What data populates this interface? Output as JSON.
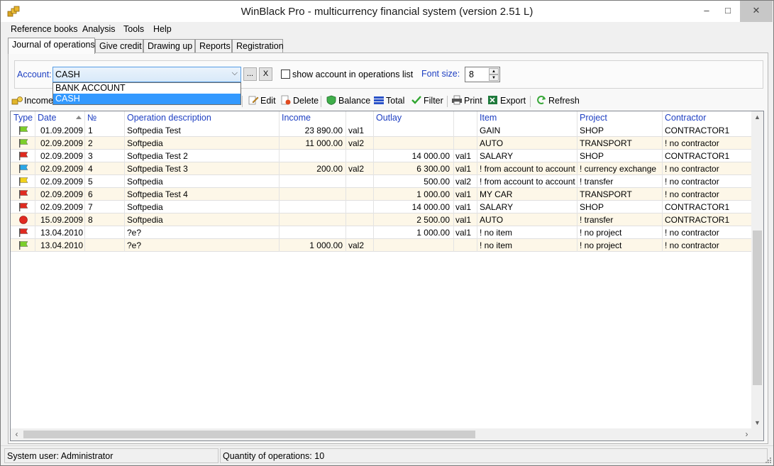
{
  "window": {
    "title": "WinBlack Pro - multicurrency financial system (version 2.51 L)",
    "minimize": "–",
    "maximize": "□",
    "close": "✕"
  },
  "menu": [
    "Reference books",
    "Analysis",
    "Tools",
    "Help"
  ],
  "tabs": [
    "Journal of operations",
    "Give credit",
    "Drawing up",
    "Reports",
    "Registration"
  ],
  "account": {
    "label": "Account:",
    "value": "CASH",
    "browse_label": "...",
    "clear_label": "X",
    "show_in_list_label": "show account in operations list",
    "show_in_list_checked": false,
    "font_size_label": "Font size:",
    "font_size_value": "8",
    "dropdown_options": [
      "BANK ACCOUNT",
      "CASH"
    ],
    "dropdown_selected": "CASH"
  },
  "toolbar": {
    "income": "Income",
    "edit": "Edit",
    "delete": "Delete",
    "balance": "Balance",
    "total": "Total",
    "filter": "Filter",
    "print": "Print",
    "export": "Export",
    "refresh": "Refresh"
  },
  "grid": {
    "columns": [
      "Type",
      "Date",
      "№",
      "Operation description",
      "Income",
      "Outlay",
      "Item",
      "Project",
      "Contractor"
    ],
    "sorted_column": "Date",
    "rows": [
      {
        "type": "green",
        "date": "01.09.2009",
        "no": "1",
        "desc": "Softpedia Test",
        "income": "23 890.00",
        "income_cur": "val1",
        "outlay": "",
        "outlay_cur": "",
        "item": "GAIN",
        "project": "SHOP",
        "contractor": "CONTRACTOR1"
      },
      {
        "type": "green",
        "date": "02.09.2009",
        "no": "2",
        "desc": "Softpedia",
        "income": "11 000.00",
        "income_cur": "val2",
        "outlay": "",
        "outlay_cur": "",
        "item": "AUTO",
        "project": "TRANSPORT",
        "contractor": "! no contractor"
      },
      {
        "type": "red",
        "date": "02.09.2009",
        "no": "3",
        "desc": "Softpedia Test 2",
        "income": "",
        "income_cur": "",
        "outlay": "14 000.00",
        "outlay_cur": "val1",
        "item": "SALARY",
        "project": "SHOP",
        "contractor": "CONTRACTOR1"
      },
      {
        "type": "blue",
        "date": "02.09.2009",
        "no": "4",
        "desc": "Softpedia Test 3",
        "income": "200.00",
        "income_cur": "val2",
        "outlay": "6 300.00",
        "outlay_cur": "val1",
        "item": "! from account to account",
        "project": "! currency exchange",
        "contractor": "! no contractor"
      },
      {
        "type": "yellow",
        "date": "02.09.2009",
        "no": "5",
        "desc": "Softpedia",
        "income": "",
        "income_cur": "",
        "outlay": "500.00",
        "outlay_cur": "val2",
        "item": "! from account to account",
        "project": "! transfer",
        "contractor": "! no contractor"
      },
      {
        "type": "red",
        "date": "02.09.2009",
        "no": "6",
        "desc": "Softpedia Test 4",
        "income": "",
        "income_cur": "",
        "outlay": "1 000.00",
        "outlay_cur": "val1",
        "item": "MY CAR",
        "project": "TRANSPORT",
        "contractor": "! no contractor"
      },
      {
        "type": "red",
        "date": "02.09.2009",
        "no": "7",
        "desc": "Softpedia",
        "income": "",
        "income_cur": "",
        "outlay": "14 000.00",
        "outlay_cur": "val1",
        "item": "SALARY",
        "project": "SHOP",
        "contractor": "CONTRACTOR1"
      },
      {
        "type": "circle",
        "date": "15.09.2009",
        "no": "8",
        "desc": "Softpedia",
        "income": "",
        "income_cur": "",
        "outlay": "2 500.00",
        "outlay_cur": "val1",
        "item": "AUTO",
        "project": "! transfer",
        "contractor": "CONTRACTOR1"
      },
      {
        "type": "red",
        "date": "13.04.2010",
        "no": "",
        "desc": "?e?",
        "income": "",
        "income_cur": "",
        "outlay": "1 000.00",
        "outlay_cur": "val1",
        "item": "! no item",
        "project": "! no project",
        "contractor": "! no contractor"
      },
      {
        "type": "green",
        "date": "13.04.2010",
        "no": "",
        "desc": "?e?",
        "income": "1 000.00",
        "income_cur": "val2",
        "outlay": "",
        "outlay_cur": "",
        "item": "! no item",
        "project": "! no project",
        "contractor": "! no contractor"
      }
    ]
  },
  "status": {
    "user": "System user: Administrator",
    "count": "Quantity of operations: 10"
  },
  "colors": {
    "accent_blue": "#1e3fc2",
    "row_alt": "#fdf7e8",
    "flag_green": "#7ccf2a",
    "flag_red": "#e02a1f",
    "flag_blue": "#2aa7e8",
    "flag_yellow": "#f2d21a",
    "dropdown_highlight": "#3399ff"
  },
  "icons": [
    "app-icon",
    "income-icon",
    "edit-icon",
    "delete-icon",
    "balance-icon",
    "total-icon",
    "filter-icon",
    "print-icon",
    "export-icon",
    "refresh-icon",
    "flag-icon",
    "circle-icon"
  ]
}
